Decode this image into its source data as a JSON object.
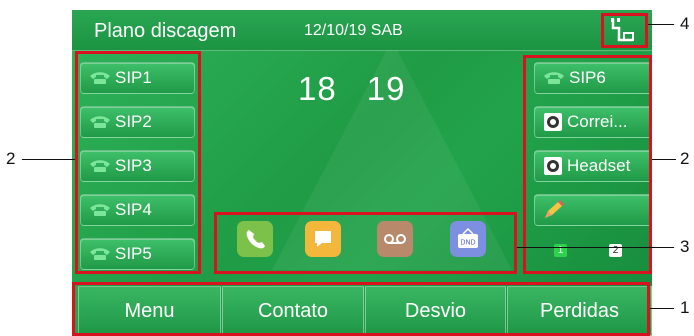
{
  "topbar": {
    "title": "Plano discagem",
    "date": "12/10/19 SAB"
  },
  "left_keys": [
    {
      "label": "SIP1"
    },
    {
      "label": "SIP2"
    },
    {
      "label": "SIP3"
    },
    {
      "label": "SIP4"
    },
    {
      "label": "SIP5"
    }
  ],
  "clock": {
    "hour": "18",
    "minute": "19"
  },
  "right_keys": [
    {
      "label": "SIP6",
      "icon": "phone-icon"
    },
    {
      "label": "Correi...",
      "icon": "voicemail-speaker-icon"
    },
    {
      "label": "Headset",
      "icon": "headset-speaker-icon"
    },
    {
      "label": "",
      "icon": "pencil-icon"
    }
  ],
  "apps": [
    {
      "icon": "call-app-icon",
      "color": "#7cc24a"
    },
    {
      "icon": "message-app-icon",
      "color": "#f3b73c"
    },
    {
      "icon": "voicemail-app-icon",
      "color": "#b88a6b"
    },
    {
      "icon": "dnd-app-icon",
      "color": "#7d8fe0",
      "text": "DND"
    }
  ],
  "pages": [
    "1",
    "2"
  ],
  "softkeys": [
    "Menu",
    "Contato",
    "Desvio",
    "Perdidas"
  ],
  "callouts": [
    "1",
    "2",
    "2",
    "3",
    "4"
  ],
  "colors": {
    "accent": "#d9121f",
    "screen": "#1f9c45"
  }
}
